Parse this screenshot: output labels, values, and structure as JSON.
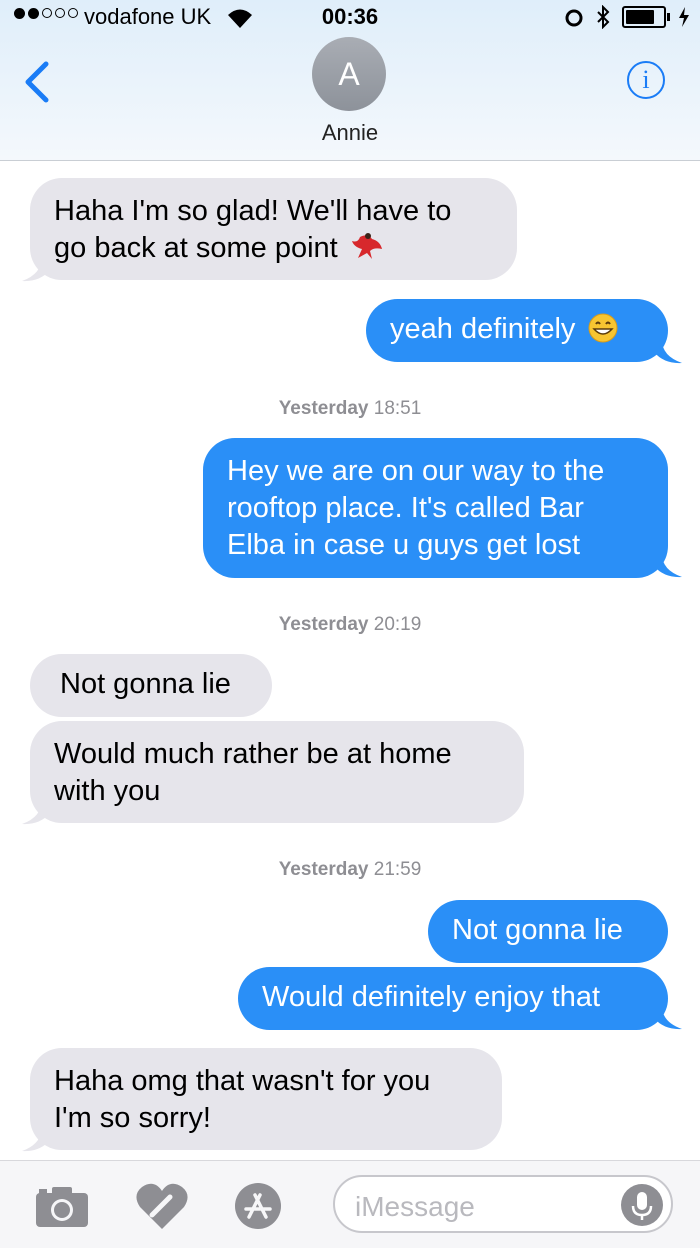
{
  "status": {
    "carrier": "vodafone UK",
    "time": "00:36"
  },
  "header": {
    "avatar_initial": "A",
    "contact_name": "Annie"
  },
  "messages": [
    {
      "from": "them",
      "lines": [
        "Haha I'm so glad! We'll have to",
        "go back at some point"
      ],
      "emoji": "dancer-emoji"
    },
    {
      "from": "me",
      "lines": [
        "yeah definitely"
      ],
      "emoji": "grin-emoji"
    },
    {
      "type": "timestamp",
      "day": "Yesterday",
      "time": "18:51"
    },
    {
      "from": "me",
      "lines": [
        "Hey we are on our way to the",
        "rooftop place. It's called Bar",
        "Elba in case u guys get lost"
      ]
    },
    {
      "type": "timestamp",
      "day": "Yesterday",
      "time": "20:19"
    },
    {
      "from": "them",
      "lines": [
        "Not gonna lie"
      ]
    },
    {
      "from": "them",
      "lines": [
        "Would much rather be at home",
        "with you"
      ]
    },
    {
      "type": "timestamp",
      "day": "Yesterday",
      "time": "21:59"
    },
    {
      "from": "me",
      "lines": [
        "Not gonna lie"
      ]
    },
    {
      "from": "me",
      "lines": [
        "Would definitely enjoy that"
      ]
    },
    {
      "from": "them",
      "lines": [
        "Haha omg that wasn't for you",
        "I'm so sorry!"
      ]
    }
  ],
  "input": {
    "placeholder": "iMessage"
  },
  "colors": {
    "sent_bubble": "#2a8ff7",
    "received_bubble": "#e6e5eb",
    "accent": "#1a7cf6"
  }
}
